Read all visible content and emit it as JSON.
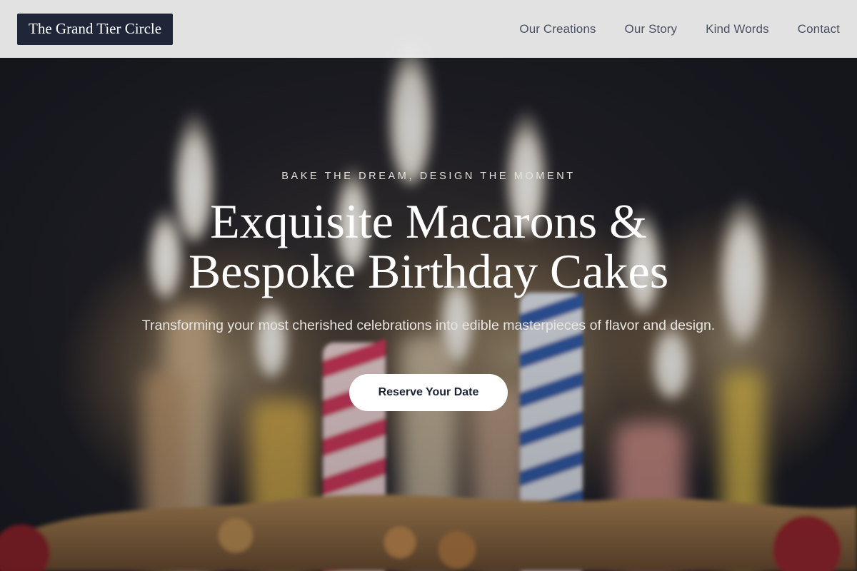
{
  "header": {
    "brand": "The Grand Tier Circle",
    "nav": [
      {
        "label": "Our Creations"
      },
      {
        "label": "Our Story"
      },
      {
        "label": "Kind Words"
      },
      {
        "label": "Contact"
      }
    ]
  },
  "hero": {
    "eyebrow": "BAKE THE DREAM, DESIGN THE MOMENT",
    "title_line1": "Exquisite Macarons &",
    "title_line2": "Bespoke Birthday Cakes",
    "subtitle": "Transforming your most cherished celebrations into edible masterpieces of flavor and design.",
    "cta_label": "Reserve Your Date"
  },
  "colors": {
    "header_bg": "#f2f2f2",
    "brand_bg": "#1e2638",
    "nav_text": "#4a5261",
    "cta_bg": "#ffffff",
    "cta_text": "#1b2233"
  }
}
